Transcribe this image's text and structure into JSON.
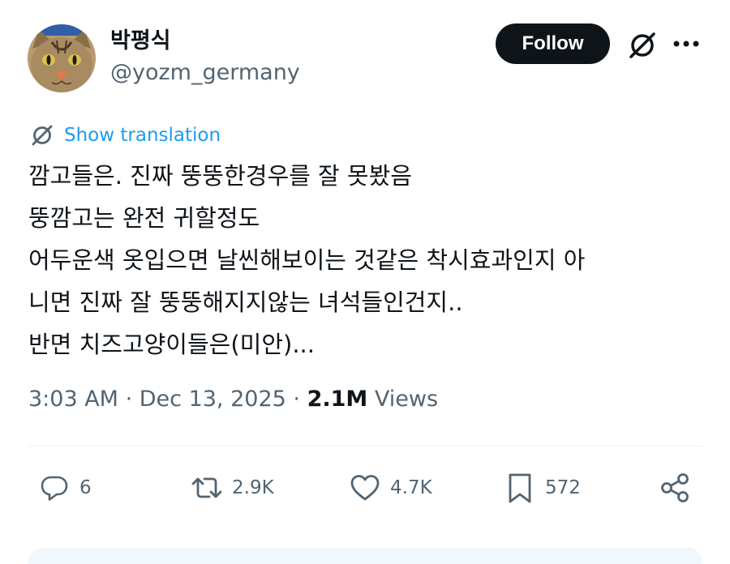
{
  "author": {
    "display_name": "박평식",
    "handle": "@yozm_germany",
    "avatar_icon": "cat-avatar"
  },
  "header": {
    "follow_label": "Follow",
    "grok_icon": "grok-icon",
    "more_icon": "more-dots-icon"
  },
  "translation": {
    "label": "Show translation",
    "icon": "grok-icon"
  },
  "tweet": {
    "lines": [
      "깜고들은. 진짜 뚱뚱한경우를 잘 못봤음",
      "뚱깜고는 완전 귀할정도",
      "어두운색 옷입으면 날씬해보이는 것같은 착시효과인지 아",
      "니면 진짜 잘 뚱뚱해지지않는 녀석들인건지..",
      "반면 치즈고양이들은(미안)..."
    ]
  },
  "meta": {
    "time": "3:03 AM",
    "date": "Dec 13, 2025",
    "views_count": "2.1M",
    "views_label": "Views"
  },
  "actions": {
    "replies": "6",
    "reposts": "2.9K",
    "likes": "4.7K",
    "bookmarks": "572"
  },
  "colors": {
    "accent": "#1d9bf0",
    "text": "#0f1419",
    "secondary": "#536471",
    "follow_bg": "#0f1419"
  }
}
